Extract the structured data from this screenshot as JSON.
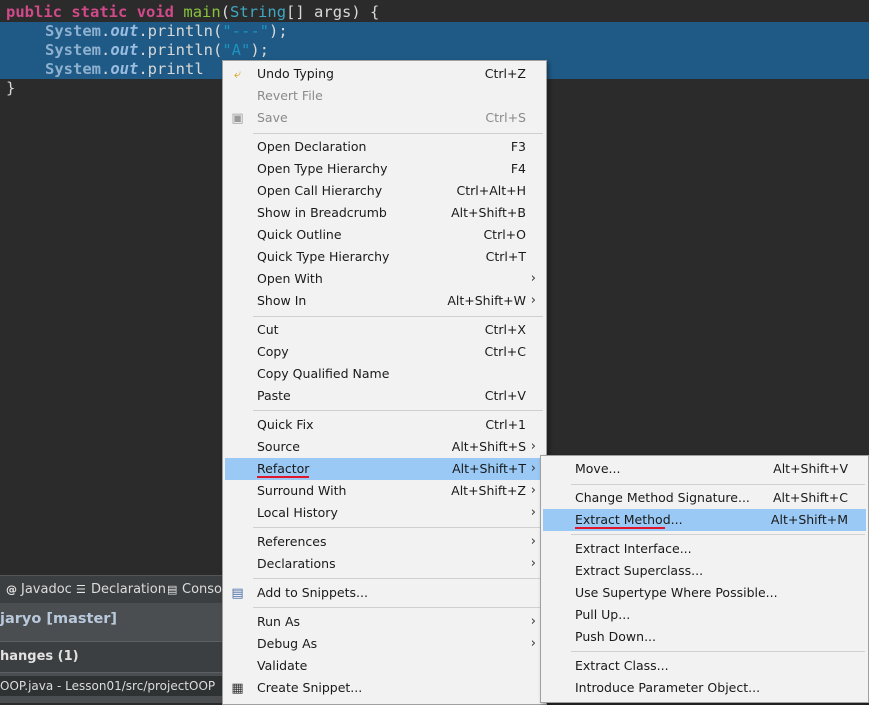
{
  "editor": {
    "line1": {
      "kw1": "public",
      "kw2": "static",
      "kw3": "void",
      "method": "main",
      "paren_open": "(",
      "type": "String",
      "rest": "[] args) {"
    },
    "line2": {
      "sys": "System",
      "dot1": ".",
      "field": "out",
      "call": ".println(",
      "str": "\"---\"",
      "end": ");"
    },
    "line3": {
      "sys": "System",
      "dot1": ".",
      "field": "out",
      "call": ".println(",
      "str": "\"A\"",
      "end": ");"
    },
    "line4": {
      "sys": "System",
      "dot1": ".",
      "field": "out",
      "call": ".printl"
    },
    "line5": {
      "brace": "}"
    }
  },
  "bottom_tabs": [
    {
      "icon": "@",
      "label": "Javadoc"
    },
    {
      "icon": "☰",
      "label": "Declaration"
    },
    {
      "icon": "▤",
      "label": "Consol"
    }
  ],
  "staging": {
    "repo": "jaryo [master]",
    "changes": "hanges (1)",
    "file": "OOP.java - Lesson01/src/projectOOP"
  },
  "context_menu": {
    "undo": {
      "label": "Undo Typing",
      "shortcut": "Ctrl+Z"
    },
    "revert": {
      "label": "Revert File"
    },
    "save": {
      "label": "Save",
      "shortcut": "Ctrl+S"
    },
    "open_declaration": {
      "label": "Open Declaration",
      "shortcut": "F3"
    },
    "open_type_hierarchy": {
      "label": "Open Type Hierarchy",
      "shortcut": "F4"
    },
    "open_call_hierarchy": {
      "label": "Open Call Hierarchy",
      "shortcut": "Ctrl+Alt+H"
    },
    "show_in_breadcrumb": {
      "label": "Show in Breadcrumb",
      "shortcut": "Alt+Shift+B"
    },
    "quick_outline": {
      "label": "Quick Outline",
      "shortcut": "Ctrl+O"
    },
    "quick_type_hierarchy": {
      "label": "Quick Type Hierarchy",
      "shortcut": "Ctrl+T"
    },
    "open_with": {
      "label": "Open With"
    },
    "show_in": {
      "label": "Show In",
      "shortcut": "Alt+Shift+W"
    },
    "cut": {
      "label": "Cut",
      "shortcut": "Ctrl+X"
    },
    "copy": {
      "label": "Copy",
      "shortcut": "Ctrl+C"
    },
    "copy_qualified_name": {
      "label": "Copy Qualified Name"
    },
    "paste": {
      "label": "Paste",
      "shortcut": "Ctrl+V"
    },
    "quick_fix": {
      "label": "Quick Fix",
      "shortcut": "Ctrl+1"
    },
    "source": {
      "label": "Source",
      "shortcut": "Alt+Shift+S"
    },
    "refactor": {
      "label": "Refactor",
      "shortcut": "Alt+Shift+T"
    },
    "surround_with": {
      "label": "Surround With",
      "shortcut": "Alt+Shift+Z"
    },
    "local_history": {
      "label": "Local History"
    },
    "references": {
      "label": "References"
    },
    "declarations": {
      "label": "Declarations"
    },
    "add_to_snippets": {
      "label": "Add to Snippets..."
    },
    "run_as": {
      "label": "Run As"
    },
    "debug_as": {
      "label": "Debug As"
    },
    "validate": {
      "label": "Validate"
    },
    "create_snippet": {
      "label": "Create Snippet..."
    },
    "arrow": "›"
  },
  "refactor_menu": {
    "move": {
      "label": "Move...",
      "shortcut": "Alt+Shift+V"
    },
    "change_method_signature": {
      "label": "Change Method Signature...",
      "shortcut": "Alt+Shift+C"
    },
    "extract_method": {
      "label": "Extract Method...",
      "shortcut": "Alt+Shift+M"
    },
    "extract_interface": {
      "label": "Extract Interface..."
    },
    "extract_superclass": {
      "label": "Extract Superclass..."
    },
    "use_supertype": {
      "label": "Use Supertype Where Possible..."
    },
    "pull_up": {
      "label": "Pull Up..."
    },
    "push_down": {
      "label": "Push Down..."
    },
    "extract_class": {
      "label": "Extract Class..."
    },
    "introduce_parameter_object": {
      "label": "Introduce Parameter Object..."
    }
  },
  "colors": {
    "editor_bg": "#2b2b2b",
    "selection": "#1e5a85",
    "menu_bg": "#f2f2f2",
    "menu_highlight": "#99c9f4",
    "annotation_underline": "#e0162a"
  }
}
